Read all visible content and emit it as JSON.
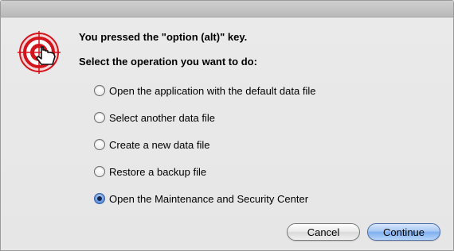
{
  "dialog": {
    "message_line1": "You pressed the \"option (alt)\" key.",
    "message_line2": "Select the operation you want to do:",
    "icon": "target-hand-icon"
  },
  "options": [
    {
      "label": "Open the application with the default data file",
      "selected": false
    },
    {
      "label": "Select another data file",
      "selected": false
    },
    {
      "label": "Create a new data file",
      "selected": false
    },
    {
      "label": "Restore a backup file",
      "selected": false
    },
    {
      "label": "Open the Maintenance and Security Center",
      "selected": true
    }
  ],
  "buttons": {
    "cancel_label": "Cancel",
    "continue_label": "Continue"
  },
  "colors": {
    "accent": "#6c9ee8",
    "icon_red": "#d4141c"
  }
}
